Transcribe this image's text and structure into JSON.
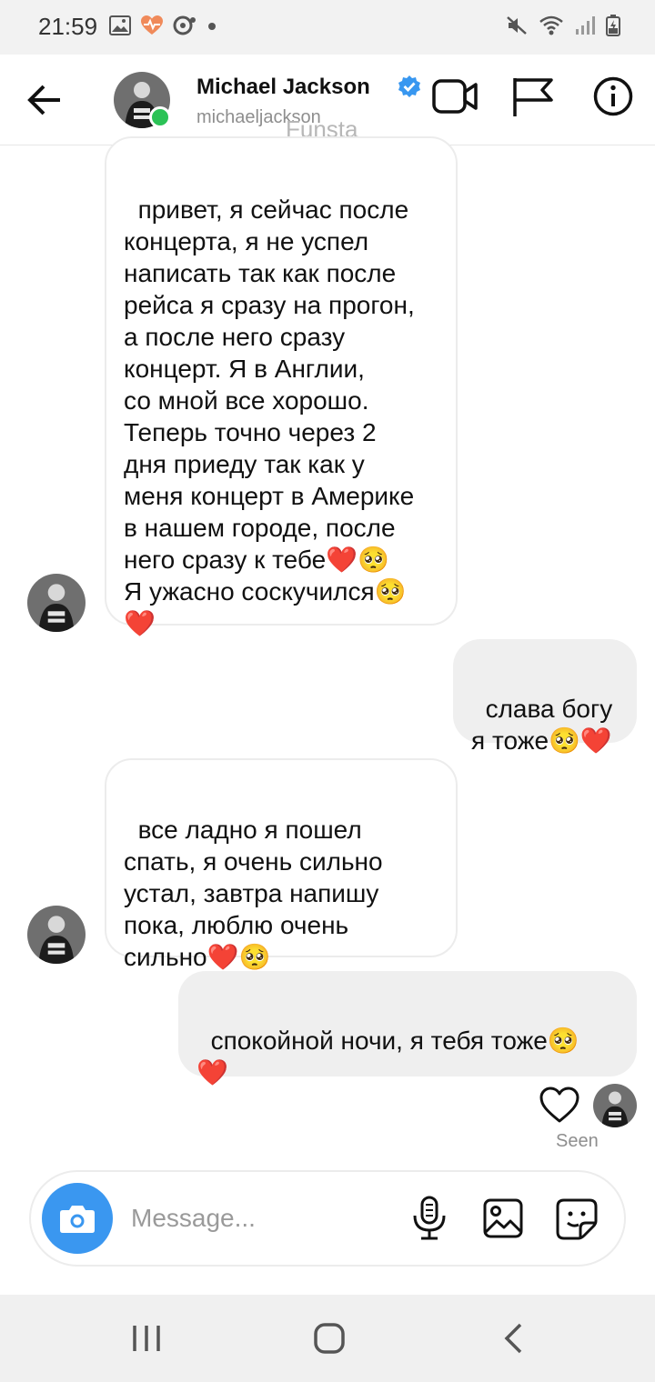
{
  "status_bar": {
    "time": "21:59"
  },
  "header": {
    "name": "Michael Jackson",
    "username": "michaeljackson",
    "overlay_label": "Funsta",
    "online_color": "#2bc256",
    "verified_color": "#3897f0"
  },
  "messages": [
    {
      "direction": "incoming",
      "text": "привет, я сейчас после\nконцерта, я не успел\nнаписать так как после\nрейса я сразу на прогон,\nа после него сразу\nконцерт. Я в Англии,\nсо мной все хорошо.\nТеперь точно через 2\nдня приеду так как у\nменя концерт в Америке\nв нашем городе, после\nнего сразу к тебе❤️🥺\nЯ ужасно соскучился🥺\n❤️"
    },
    {
      "direction": "outgoing",
      "text": "слава богу\nя тоже🥺❤️"
    },
    {
      "direction": "incoming",
      "text": "все ладно я пошел\nспать, я очень сильно\nустал, завтра напишу\nпока, люблю очень\nсильно❤️🥺"
    },
    {
      "direction": "outgoing",
      "text": "спокойной ночи, я тебя тоже🥺\n❤️"
    }
  ],
  "seen": {
    "label": "Seen"
  },
  "composer": {
    "placeholder": "Message...",
    "camera_color": "#3a97f0"
  },
  "icons": {
    "back": "arrow-left-icon",
    "video": "video-camera-icon",
    "flag": "flag-icon",
    "info": "info-icon",
    "heart": "heart-outline-icon",
    "mic": "microphone-icon",
    "gallery": "image-icon",
    "sticker": "sticker-icon"
  }
}
